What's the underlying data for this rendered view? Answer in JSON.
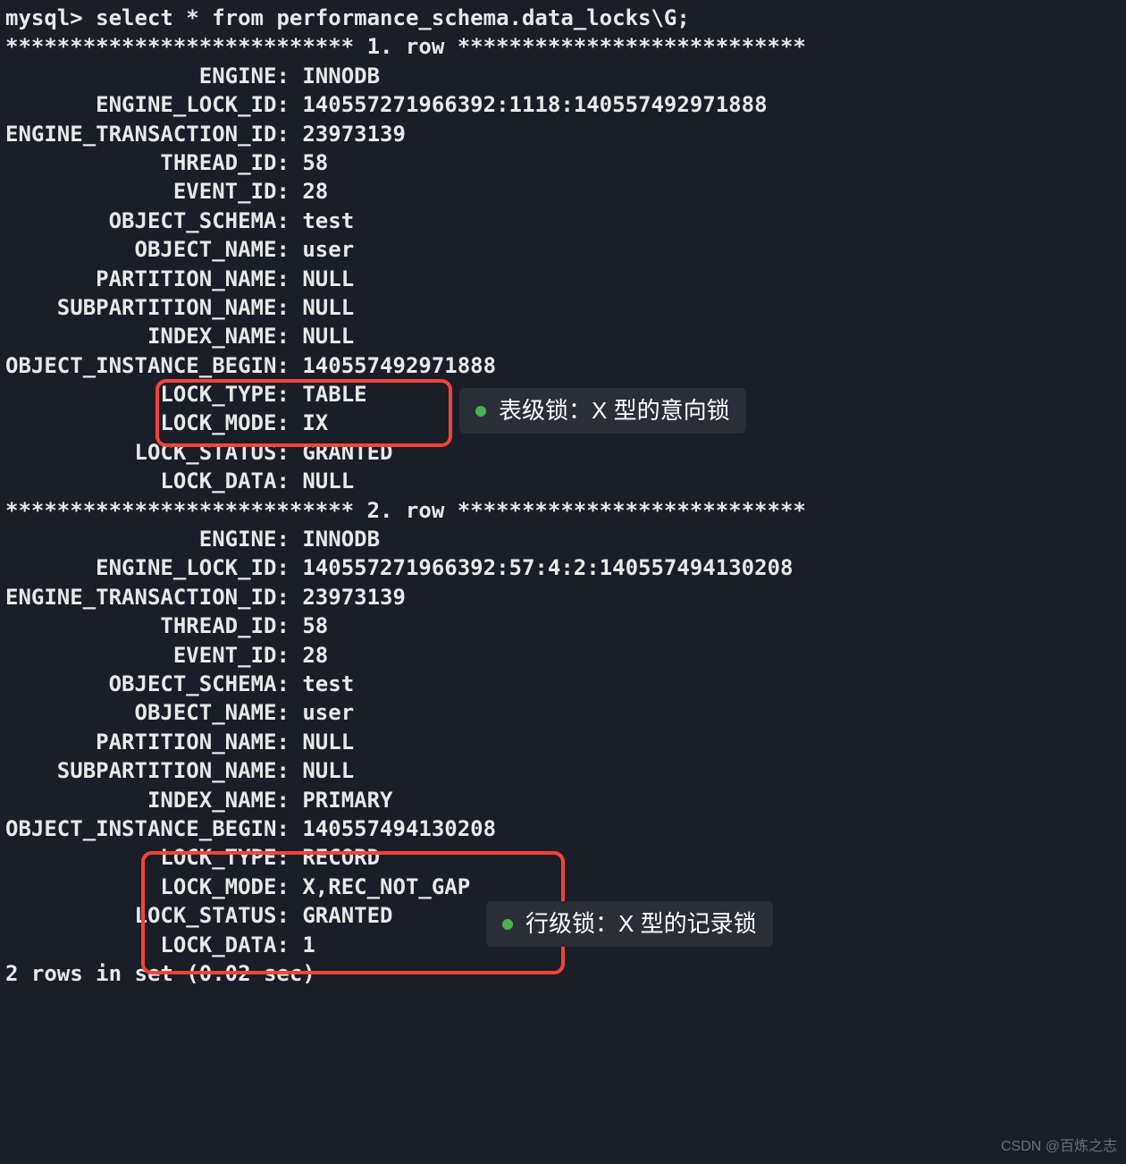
{
  "prompt": "mysql> ",
  "query": "select * from performance_schema.data_locks\\G;",
  "row1_header": "*************************** 1. row ***************************",
  "row2_header": "*************************** 2. row ***************************",
  "footer": "2 rows in set (0.02 sec)",
  "rows": [
    {
      "ENGINE": "INNODB",
      "ENGINE_LOCK_ID": "140557271966392:1118:140557492971888",
      "ENGINE_TRANSACTION_ID": "23973139",
      "THREAD_ID": "58",
      "EVENT_ID": "28",
      "OBJECT_SCHEMA": "test",
      "OBJECT_NAME": "user",
      "PARTITION_NAME": "NULL",
      "SUBPARTITION_NAME": "NULL",
      "INDEX_NAME": "NULL",
      "OBJECT_INSTANCE_BEGIN": "140557492971888",
      "LOCK_TYPE": "TABLE",
      "LOCK_MODE": "IX",
      "LOCK_STATUS": "GRANTED",
      "LOCK_DATA": "NULL"
    },
    {
      "ENGINE": "INNODB",
      "ENGINE_LOCK_ID": "140557271966392:57:4:2:140557494130208",
      "ENGINE_TRANSACTION_ID": "23973139",
      "THREAD_ID": "58",
      "EVENT_ID": "28",
      "OBJECT_SCHEMA": "test",
      "OBJECT_NAME": "user",
      "PARTITION_NAME": "NULL",
      "SUBPARTITION_NAME": "NULL",
      "INDEX_NAME": "PRIMARY",
      "OBJECT_INSTANCE_BEGIN": "140557494130208",
      "LOCK_TYPE": "RECORD",
      "LOCK_MODE": "X,REC_NOT_GAP",
      "LOCK_STATUS": "GRANTED",
      "LOCK_DATA": "1"
    }
  ],
  "labels": {
    "ENGINE": "               ENGINE",
    "ENGINE_LOCK_ID": "       ENGINE_LOCK_ID",
    "ENGINE_TRANSACTION_ID": "ENGINE_TRANSACTION_ID",
    "THREAD_ID": "            THREAD_ID",
    "EVENT_ID": "             EVENT_ID",
    "OBJECT_SCHEMA": "        OBJECT_SCHEMA",
    "OBJECT_NAME": "          OBJECT_NAME",
    "PARTITION_NAME": "       PARTITION_NAME",
    "SUBPARTITION_NAME": "    SUBPARTITION_NAME",
    "INDEX_NAME": "           INDEX_NAME",
    "OBJECT_INSTANCE_BEGIN": "OBJECT_INSTANCE_BEGIN",
    "LOCK_TYPE": "            LOCK_TYPE",
    "LOCK_MODE": "            LOCK_MODE",
    "LOCK_STATUS": "          LOCK_STATUS",
    "LOCK_DATA": "            LOCK_DATA"
  },
  "annotations": {
    "table_lock": "表级锁：X 型的意向锁",
    "row_lock": "行级锁：X 型的记录锁"
  },
  "watermark": "CSDN @百炼之志"
}
